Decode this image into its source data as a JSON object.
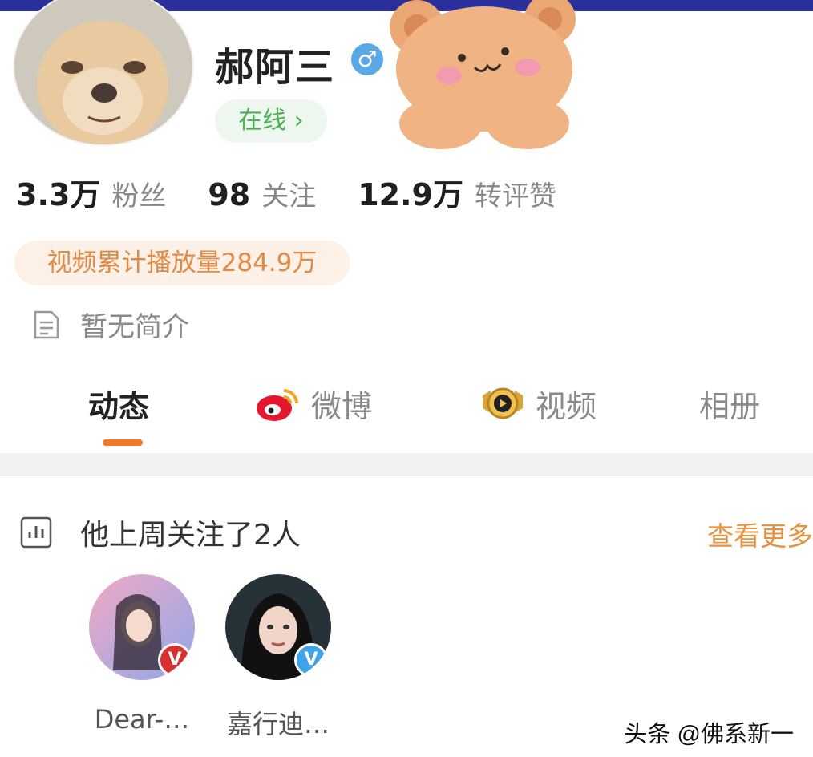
{
  "profile": {
    "name": "郝阿三",
    "gender_icon": "male-icon",
    "gender_symbol": "♂",
    "status_label": "在线 ›"
  },
  "stats": [
    {
      "value": "3.3万",
      "label": "粉丝"
    },
    {
      "value": "98",
      "label": "关注"
    },
    {
      "value": "12.9万",
      "label": "转评赞"
    }
  ],
  "video_plays": "视频累计播放量284.9万",
  "bio": {
    "icon": "document-icon",
    "text": "暂无简介"
  },
  "tabs": [
    {
      "label": "动态",
      "icon": null,
      "active": true
    },
    {
      "label": "微博",
      "icon": "weibo-icon",
      "active": false
    },
    {
      "label": "视频",
      "icon": "video-badge-icon",
      "active": false
    },
    {
      "label": "相册",
      "icon": null,
      "active": false
    }
  ],
  "follow_section": {
    "icon": "bar-chart-icon",
    "title": "他上周关注了2人",
    "see_more": "查看更多"
  },
  "followed_users": [
    {
      "name": "Dear-…",
      "badge_symbol": "V",
      "badge_color": "#d8302f"
    },
    {
      "name": "嘉行迪…",
      "badge_symbol": "V",
      "badge_color": "#3fa3ea"
    }
  ],
  "watermark": "头条 @佛系新一",
  "colors": {
    "accent_orange": "#f07a26",
    "online_green": "#4caf50",
    "top_bar": "#2b2f9c"
  }
}
